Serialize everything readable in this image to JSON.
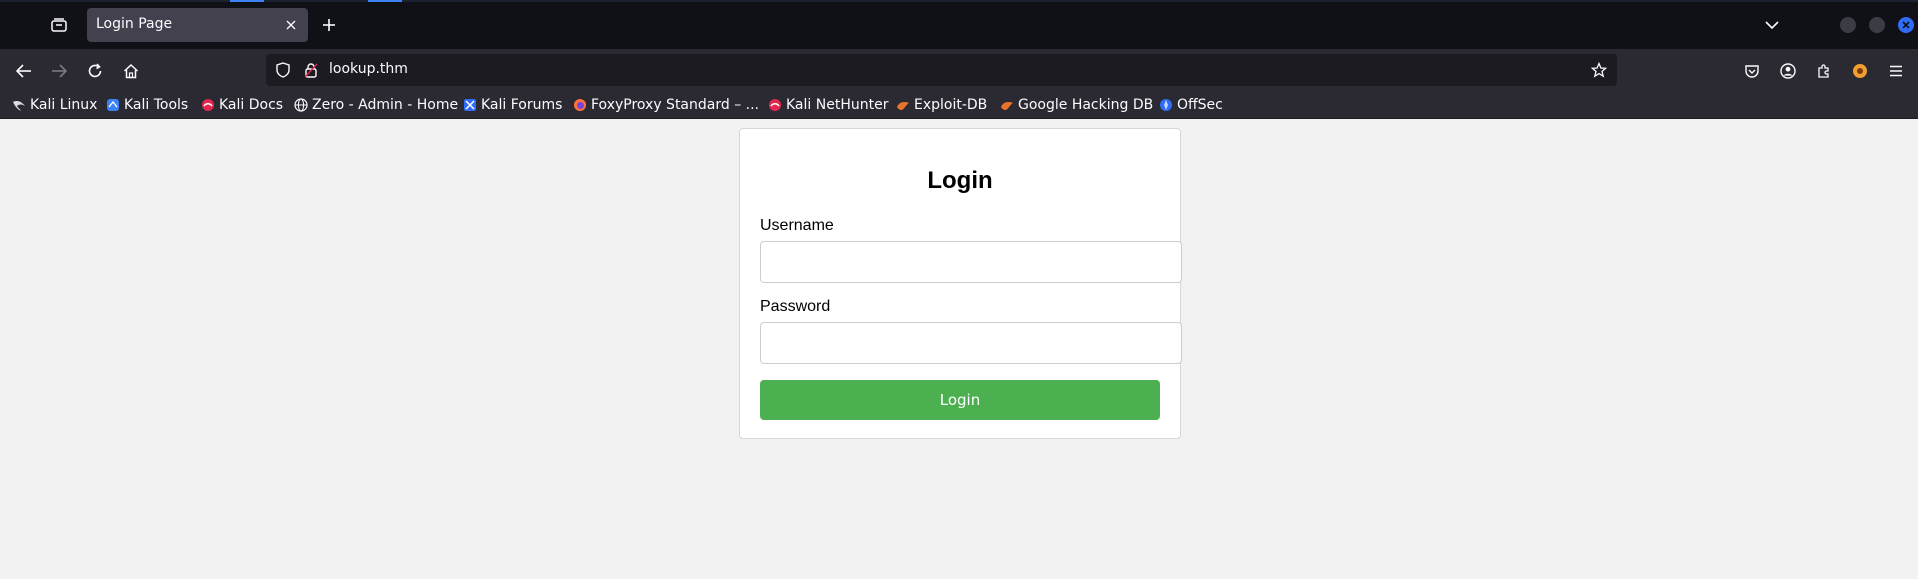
{
  "browser": {
    "tab": {
      "title": "Login Page"
    },
    "url": "lookup.thm",
    "bookmarks": [
      {
        "label": "Kali Linux",
        "icon": "kali-dragon-icon"
      },
      {
        "label": "Kali Tools",
        "icon": "kali-tools-icon"
      },
      {
        "label": "Kali Docs",
        "icon": "kali-docs-icon"
      },
      {
        "label": "Zero - Admin - Home",
        "icon": "globe-icon"
      },
      {
        "label": "Kali Forums",
        "icon": "kali-forums-icon"
      },
      {
        "label": "FoxyProxy Standard – ...",
        "icon": "firefox-icon"
      },
      {
        "label": "Kali NetHunter",
        "icon": "kali-nethunter-icon"
      },
      {
        "label": "Exploit-DB",
        "icon": "exploit-db-icon"
      },
      {
        "label": "Google Hacking DB",
        "icon": "ghdb-icon"
      },
      {
        "label": "OffSec",
        "icon": "offsec-icon"
      }
    ],
    "colors": {
      "tabstrip": "#0f1117",
      "toolbar": "#2b2a33",
      "urlbar": "#1c1b22",
      "accent": "#2f6df6"
    }
  },
  "login": {
    "title": "Login",
    "username_label": "Username",
    "password_label": "Password",
    "button_label": "Login",
    "button_color": "#4caf50"
  }
}
